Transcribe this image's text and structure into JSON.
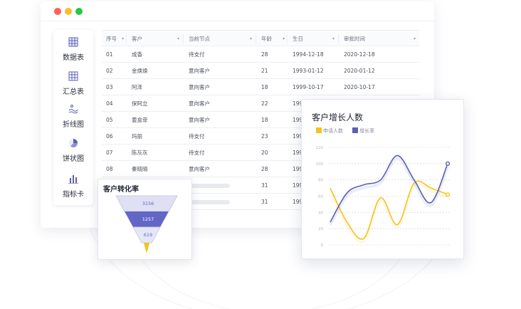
{
  "window": {
    "traffic_lights": [
      "#ff5f57",
      "#febc2e",
      "#28c840"
    ]
  },
  "sidebar": {
    "items": [
      {
        "label": "数据表",
        "icon": "table-icon"
      },
      {
        "label": "汇总表",
        "icon": "summary-table-icon"
      },
      {
        "label": "折线图",
        "icon": "line-chart-icon"
      },
      {
        "label": "饼状图",
        "icon": "pie-chart-icon"
      },
      {
        "label": "指标卡",
        "icon": "bar-indicator-icon"
      }
    ]
  },
  "table": {
    "headers": [
      "序号",
      "客户",
      "当前节点",
      "年龄",
      "生日",
      "审批时间"
    ],
    "rows": [
      [
        "01",
        "成香",
        "待支付",
        "28",
        "1994-12-18",
        "2020-12-18"
      ],
      [
        "02",
        "金焕焕",
        "意向客户",
        "21",
        "1993-01-12",
        "2020-01-12"
      ],
      [
        "03",
        "阿泽",
        "意向客户",
        "18",
        "1999-10-17",
        "2020-10-17"
      ],
      [
        "04",
        "保阿立",
        "意向客户",
        "22",
        "199",
        ""
      ],
      [
        "05",
        "姜盒菲",
        "意向客户",
        "18",
        "199",
        ""
      ],
      [
        "06",
        "玛丽",
        "待支付",
        "23",
        "199",
        ""
      ],
      [
        "07",
        "陈灰灰",
        "待支付",
        "20",
        "199",
        ""
      ],
      [
        "08",
        "秦晓晴",
        "意向客户",
        "28",
        "199",
        ""
      ],
      [
        "",
        "",
        "",
        "31",
        "199",
        ""
      ],
      [
        "",
        "",
        "",
        "31",
        "199",
        ""
      ]
    ]
  },
  "funnel": {
    "title": "客户转化率",
    "stages": [
      "3156",
      "1257",
      "619"
    ],
    "colors": [
      "#dfe0f3",
      "#6366c7",
      "#e6e7f5",
      "#f5c21a"
    ]
  },
  "chart_data": {
    "type": "line",
    "title": "客户增长人数",
    "series": [
      {
        "name": "申请人数",
        "color": "#f5c21a",
        "x": [
          0,
          1,
          2,
          3,
          4,
          5,
          6,
          7
        ],
        "values": [
          70,
          28,
          8,
          58,
          25,
          76,
          70,
          62
        ]
      },
      {
        "name": "增长率",
        "color": "#5b5fb8",
        "x": [
          0,
          1,
          2,
          3,
          4,
          5,
          6,
          7
        ],
        "values": [
          28,
          64,
          74,
          80,
          110,
          80,
          52,
          100
        ]
      }
    ],
    "y_ticks": [
      "0",
      "20",
      "40",
      "60",
      "80",
      "100",
      "120"
    ],
    "ylim": [
      0,
      120
    ],
    "grid": true,
    "legend": "top-left"
  }
}
